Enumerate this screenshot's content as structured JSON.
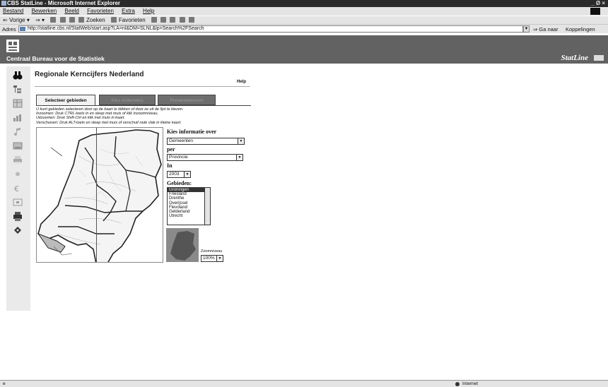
{
  "window": {
    "title": "CBS StatLine - Microsoft Internet Explorer",
    "controls": "_ Ø ×"
  },
  "menubar": [
    "Bestand",
    "Bewerken",
    "Beeld",
    "Favorieten",
    "Extra",
    "Help"
  ],
  "toolbar": {
    "back": "Vorige",
    "search": "Zoeken",
    "favorites": "Favorieten"
  },
  "address": {
    "label": "Adres",
    "url": "http://statline.cbs.nl/StatWeb/start.asp?LA=nl&DM=SLNL&lp=Search%2FSearch",
    "go": "Ga naar",
    "links": "Koppelingen"
  },
  "site": {
    "name": "Centraal Bureau voor de Statistiek",
    "brand": "StatLine"
  },
  "nav_icons": [
    "binoculars-icon",
    "tree-icon",
    "table-icon",
    "chart-icon",
    "music-icon",
    "save-icon",
    "print-icon",
    "settings-icon",
    "eurosign-icon",
    "box-icon",
    "printer-icon",
    "disk-icon"
  ],
  "page": {
    "title": "Regionale Kerncijfers Nederland",
    "help": "Help"
  },
  "tabs": [
    {
      "label": "Selecteer gebieden",
      "active": true
    },
    {
      "label": "Kies onderwerp",
      "active": false
    },
    {
      "label": "Presentatievorm",
      "active": false
    }
  ],
  "instructions": [
    "U kunt gebieden selecteren door op de kaart te klikken of door ze uit de lijst te kiezen.",
    "Inzoomen: Druk CTRL-toets in en sleep met muis of klik inzoomniveau.",
    "Uitzoomen: Druk Shift-Ctrl en klik met muis in kaart.",
    "Verschuiven: Druk ALT-toets en sleep met muis of verschuif rode vlak in kleine kaart."
  ],
  "form": {
    "kies_label": "Kies informatie over",
    "kies_value": "Gemeenten",
    "per_label": "per",
    "per_value": "Provincie",
    "in_label": "In",
    "in_value": "2003",
    "gebieden_label": "Gebieden:",
    "gebieden": [
      "Groningen",
      "Friesland",
      "Drenthe",
      "Overijssel",
      "Flevoland",
      "Gelderland",
      "Utrecht"
    ],
    "zoom_label": "Zoomniveau",
    "zoom_value": "100%"
  },
  "status": {
    "zone": "Internet"
  },
  "colors": {
    "header_bg": "#626262",
    "nav_bg": "#eaeaea",
    "selection": "#333333"
  }
}
